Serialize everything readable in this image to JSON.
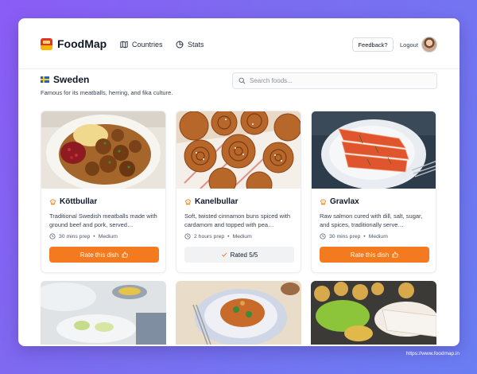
{
  "app": {
    "name": "FoodMap"
  },
  "nav": {
    "countries_label": "Countries",
    "stats_label": "Stats",
    "feedback_label": "Feedback?",
    "logout_label": "Logout"
  },
  "country": {
    "name": "Sweden",
    "description": "Famous for its meatballs, herring, and fika culture."
  },
  "search": {
    "placeholder": "Search foods..."
  },
  "foods": [
    {
      "name": "Köttbullar",
      "description": "Traditional Swedish meatballs made with ground beef and pork, served…",
      "prep": "30 mins prep",
      "difficulty": "Medium",
      "action_label": "Rate this dish",
      "rated": false
    },
    {
      "name": "Kanelbullar",
      "description": "Soft, twisted cinnamon buns spiced with cardamom and topped with pea…",
      "prep": "2 hours prep",
      "difficulty": "Medium",
      "action_label": "Rated 5/5",
      "rated": true
    },
    {
      "name": "Gravlax",
      "description": "Raw salmon cured with dill, salt, sugar, and spices, traditionally serve…",
      "prep": "30 mins prep",
      "difficulty": "Medium",
      "action_label": "Rate this dish",
      "rated": false
    }
  ],
  "footer": {
    "url": "https://www.foodmap.in"
  },
  "colors": {
    "accent": "#f47a1f",
    "background_start": "#8b5cf6",
    "background_end": "#6a7df2"
  },
  "icons": [
    "map-icon",
    "pie-chart-icon",
    "search-icon",
    "chef-hat-icon",
    "clock-icon",
    "thumbs-up-icon",
    "check-icon"
  ]
}
